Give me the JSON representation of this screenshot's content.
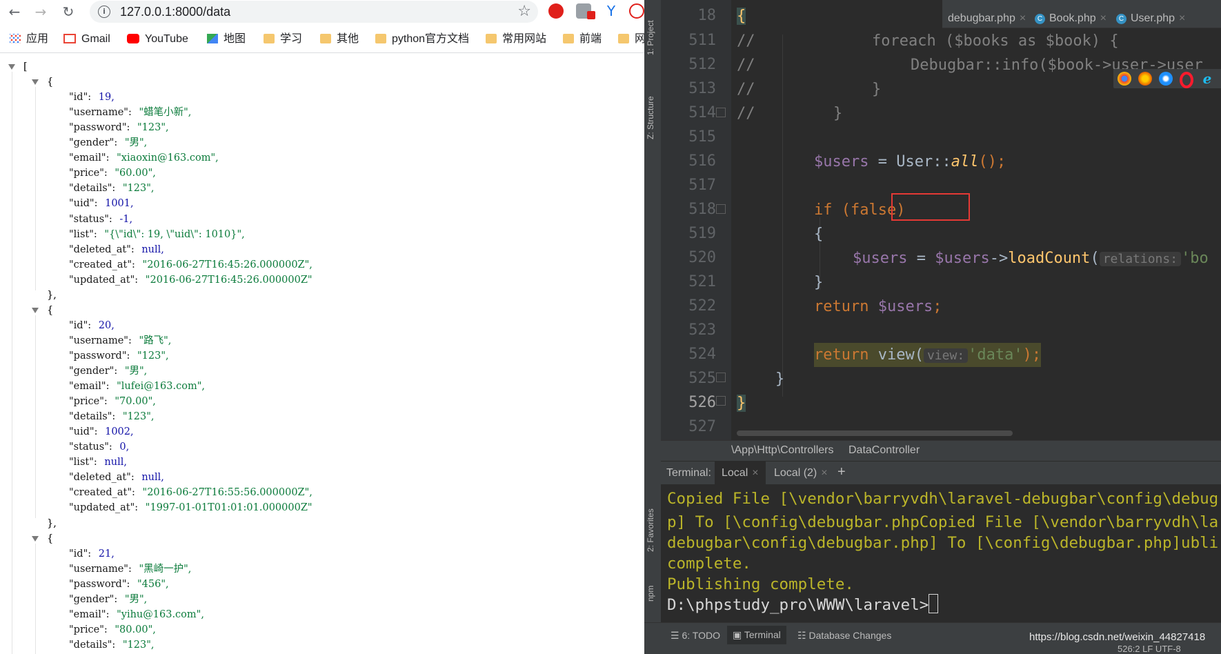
{
  "browser": {
    "url": "127.0.0.1:8000/data",
    "bookmarks": [
      "应用",
      "Gmail",
      "YouTube",
      "地图",
      "学习",
      "其他",
      "python官方文档",
      "常用网站",
      "前端",
      "网"
    ],
    "json_lines": [
      {
        "type": "open",
        "text": "[",
        "indent": 0,
        "tri": true
      },
      {
        "type": "open",
        "text": "{",
        "indent": 1,
        "tri": true
      },
      {
        "type": "kv",
        "key": "\"id\":",
        "val": "19,",
        "cls": "n"
      },
      {
        "type": "kv",
        "key": "\"username\":",
        "val": "\"蜡笔小新\",",
        "cls": "s"
      },
      {
        "type": "kv",
        "key": "\"password\":",
        "val": "\"123\",",
        "cls": "s"
      },
      {
        "type": "kv",
        "key": "\"gender\":",
        "val": "\"男\",",
        "cls": "s"
      },
      {
        "type": "kv",
        "key": "\"email\":",
        "val": "\"xiaoxin@163.com\",",
        "cls": "s"
      },
      {
        "type": "kv",
        "key": "\"price\":",
        "val": "\"60.00\",",
        "cls": "s"
      },
      {
        "type": "kv",
        "key": "\"details\":",
        "val": "\"123\",",
        "cls": "s"
      },
      {
        "type": "kv",
        "key": "\"uid\":",
        "val": "1001,",
        "cls": "n"
      },
      {
        "type": "kv",
        "key": "\"status\":",
        "val": "-1,",
        "cls": "n"
      },
      {
        "type": "kv",
        "key": "\"list\":",
        "val": "\"{\\\"id\\\": 19, \\\"uid\\\": 1010}\",",
        "cls": "s"
      },
      {
        "type": "kv",
        "key": "\"deleted_at\":",
        "val": "null,",
        "cls": "nl"
      },
      {
        "type": "kv",
        "key": "\"created_at\":",
        "val": "\"2016-06-27T16:45:26.000000Z\",",
        "cls": "s"
      },
      {
        "type": "kv",
        "key": "\"updated_at\":",
        "val": "\"2016-06-27T16:45:26.000000Z\"",
        "cls": "s"
      },
      {
        "type": "close",
        "text": "},",
        "indent": 1
      },
      {
        "type": "open",
        "text": "{",
        "indent": 1,
        "tri": true
      },
      {
        "type": "kv",
        "key": "\"id\":",
        "val": "20,",
        "cls": "n"
      },
      {
        "type": "kv",
        "key": "\"username\":",
        "val": "\"路飞\",",
        "cls": "s"
      },
      {
        "type": "kv",
        "key": "\"password\":",
        "val": "\"123\",",
        "cls": "s"
      },
      {
        "type": "kv",
        "key": "\"gender\":",
        "val": "\"男\",",
        "cls": "s"
      },
      {
        "type": "kv",
        "key": "\"email\":",
        "val": "\"lufei@163.com\",",
        "cls": "s"
      },
      {
        "type": "kv",
        "key": "\"price\":",
        "val": "\"70.00\",",
        "cls": "s"
      },
      {
        "type": "kv",
        "key": "\"details\":",
        "val": "\"123\",",
        "cls": "s"
      },
      {
        "type": "kv",
        "key": "\"uid\":",
        "val": "1002,",
        "cls": "n"
      },
      {
        "type": "kv",
        "key": "\"status\":",
        "val": "0,",
        "cls": "n"
      },
      {
        "type": "kv",
        "key": "\"list\":",
        "val": "null,",
        "cls": "nl"
      },
      {
        "type": "kv",
        "key": "\"deleted_at\":",
        "val": "null,",
        "cls": "nl"
      },
      {
        "type": "kv",
        "key": "\"created_at\":",
        "val": "\"2016-06-27T16:55:56.000000Z\",",
        "cls": "s"
      },
      {
        "type": "kv",
        "key": "\"updated_at\":",
        "val": "\"1997-01-01T01:01:01.000000Z\"",
        "cls": "s"
      },
      {
        "type": "close",
        "text": "},",
        "indent": 1
      },
      {
        "type": "open",
        "text": "{",
        "indent": 1,
        "tri": true
      },
      {
        "type": "kv",
        "key": "\"id\":",
        "val": "21,",
        "cls": "n"
      },
      {
        "type": "kv",
        "key": "\"username\":",
        "val": "\"黑崎一护\",",
        "cls": "s"
      },
      {
        "type": "kv",
        "key": "\"password\":",
        "val": "\"456\",",
        "cls": "s"
      },
      {
        "type": "kv",
        "key": "\"gender\":",
        "val": "\"男\",",
        "cls": "s"
      },
      {
        "type": "kv",
        "key": "\"email\":",
        "val": "\"yihu@163.com\",",
        "cls": "s"
      },
      {
        "type": "kv",
        "key": "\"price\":",
        "val": "\"80.00\",",
        "cls": "s"
      },
      {
        "type": "kv",
        "key": "\"details\":",
        "val": "\"123\",",
        "cls": "s"
      }
    ]
  },
  "ide": {
    "tool_labels": [
      "1: Project",
      "Z: Structure",
      "2: Favorites",
      "npm"
    ],
    "file_tabs": [
      "debugbar.php",
      "Book.php",
      "User.php"
    ],
    "line_numbers": [
      "18",
      "511",
      "512",
      "513",
      "514",
      "515",
      "516",
      "517",
      "518",
      "519",
      "520",
      "521",
      "522",
      "523",
      "524",
      "525",
      "526",
      "527"
    ],
    "code": {
      "l18": "{",
      "l511_c": "//",
      "l511": "foreach ($books as $book) {",
      "l512_c": "//",
      "l512": "Debugbar::info($book->user->user",
      "l513_c": "//",
      "l513": "}",
      "l514_c": "//",
      "l514": "}",
      "l516_var": "$users",
      "l516_eq": " = User::",
      "l516_fn": "all",
      "l516_end": "();",
      "l518_kw": "if",
      "l518_rest": " (false)",
      "l519": "{",
      "l520_var": "$users",
      "l520_eq": " = ",
      "l520_var2": "$users",
      "l520_arrow": "->",
      "l520_fn": "loadCount",
      "l520_paren": "(",
      "l520_hint": "relations:",
      "l520_str": "'bo",
      "l521": "}",
      "l522_kw": "return",
      "l522_var": " $users",
      "l522_end": ";",
      "l524_kw": "return",
      "l524_fn": " view(",
      "l524_hint": "view:",
      "l524_str": "'data'",
      "l524_end": ");",
      "l525": "}",
      "l526": "}"
    },
    "breadcrumb": [
      "\\App\\Http\\Controllers",
      "DataController"
    ],
    "terminal_label": "Terminal:",
    "terminal_tabs": [
      "Local",
      "Local (2)"
    ],
    "terminal_add": "+",
    "terminal_lines": [
      "Copied File [\\vendor\\barryvdh\\laravel-debugbar\\config\\debug",
      "p] To [\\config\\debugbar.phpCopied File [\\vendor\\barryvdh\\la",
      "debugbar\\config\\debugbar.php] To [\\config\\debugbar.php]ubli",
      "complete.",
      "Publishing complete.",
      "D:\\phpstudy_pro\\WWW\\laravel>"
    ],
    "status_tabs": [
      "6: TODO",
      "Terminal",
      "Database Changes"
    ],
    "status_right": "https://blog.csdn.net/weixin_44827418",
    "status_pos": "526:2   LF   UTF-8"
  },
  "colors": {
    "highlight_box": "#e53935",
    "accent": "#3592c4"
  }
}
